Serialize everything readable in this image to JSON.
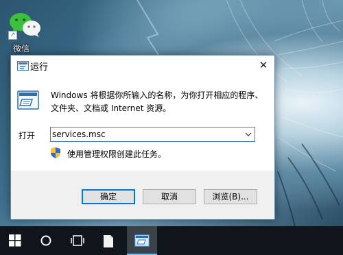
{
  "desktop": {
    "wechat_icon": {
      "label": "微信"
    }
  },
  "run_dialog": {
    "title": "运行",
    "close_glyph": "✕",
    "description": "Windows 将根据你所输入的名称，为你打开相应的程序、文件夹、文档或 Internet 资源。",
    "open_label": "打开",
    "open_value": "services.msc",
    "admin_note": "使用管理权限创建此任务。",
    "buttons": {
      "ok": "确定",
      "cancel": "取消",
      "browse": "浏览(B)..."
    }
  },
  "taskbar": {
    "items": [
      "start-button",
      "search-button",
      "task-view-button",
      "file-explorer-button",
      "run-button"
    ]
  },
  "colors": {
    "accent": "#0078d7",
    "taskbar": "#0f151b",
    "dialog_footer": "#f0f0f0"
  }
}
